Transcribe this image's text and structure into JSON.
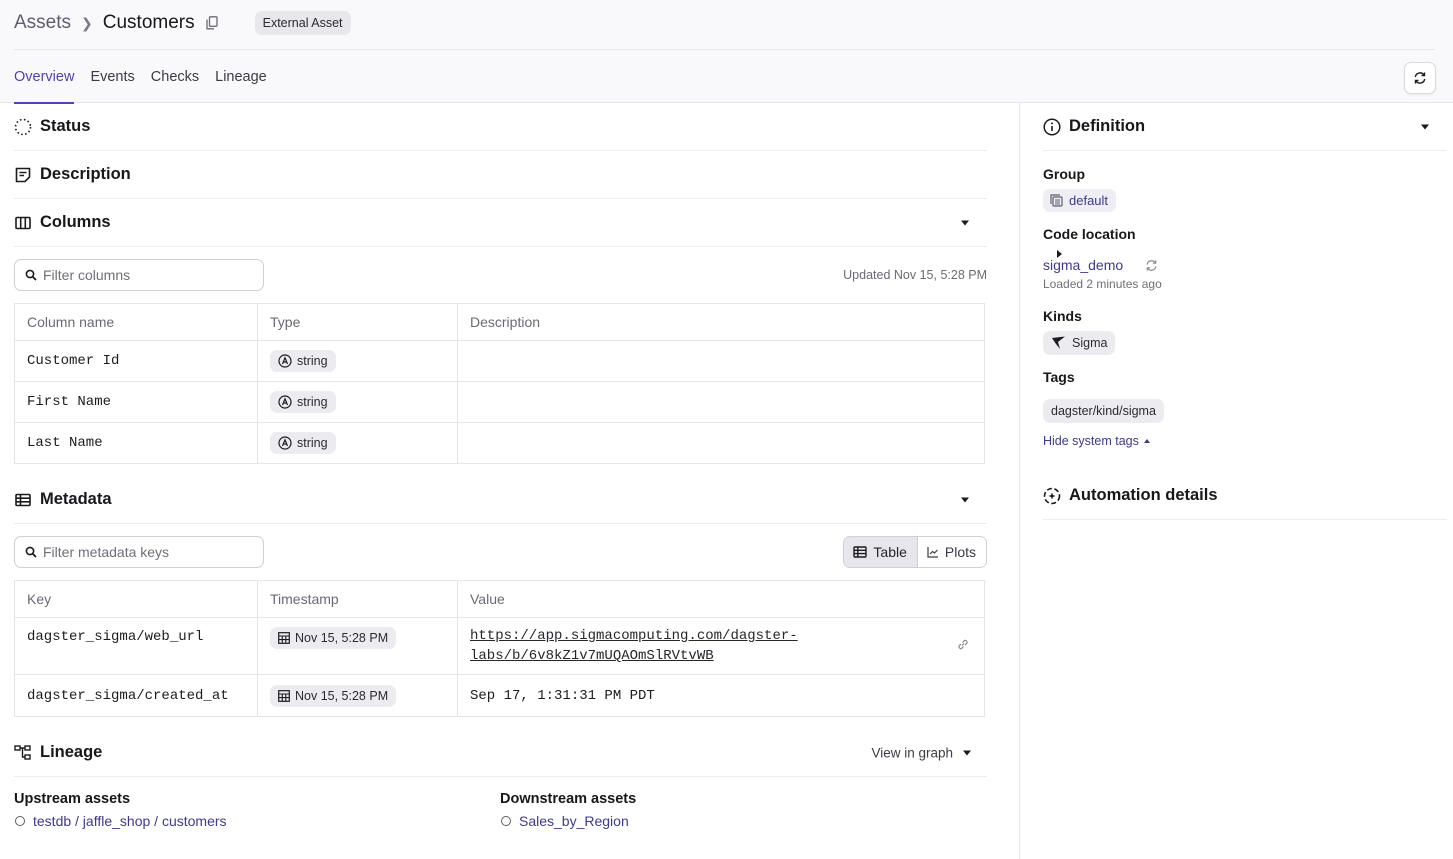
{
  "header": {
    "breadcrumb_root": "Assets",
    "breadcrumb_current": "Customers",
    "badge": "External Asset",
    "tabs": [
      {
        "label": "Overview",
        "active": true
      },
      {
        "label": "Events",
        "active": false
      },
      {
        "label": "Checks",
        "active": false
      },
      {
        "label": "Lineage",
        "active": false
      }
    ],
    "accent_color": "#4f43b0"
  },
  "sections": {
    "status": {
      "title": "Status",
      "icon": "loading-dots-icon",
      "expanded": false
    },
    "description": {
      "title": "Description",
      "icon": "note-icon",
      "expanded": false
    },
    "columns": {
      "title": "Columns",
      "icon": "columns-icon",
      "expanded": true
    },
    "metadata": {
      "title": "Metadata",
      "icon": "table-icon",
      "expanded": true
    },
    "lineage": {
      "title": "Lineage",
      "icon": "lineage-icon",
      "expanded": true
    }
  },
  "columns": {
    "filter_placeholder": "Filter columns",
    "updated": "Updated Nov 15, 5:28 PM",
    "headers": [
      "Column name",
      "Type",
      "Description"
    ],
    "rows": [
      {
        "name": "Customer Id",
        "type": "string",
        "description": ""
      },
      {
        "name": "First Name",
        "type": "string",
        "description": ""
      },
      {
        "name": "Last Name",
        "type": "string",
        "description": ""
      }
    ]
  },
  "metadata": {
    "filter_placeholder": "Filter metadata keys",
    "view_toggle": [
      {
        "label": "Table",
        "active": true
      },
      {
        "label": "Plots",
        "active": false
      }
    ],
    "headers": [
      "Key",
      "Timestamp",
      "Value"
    ],
    "rows": [
      {
        "key": "dagster_sigma/web_url",
        "timestamp": "Nov 15, 5:28 PM",
        "value_line1": "https://app.sigmacomputing.com/dagster-",
        "value_line2": "labs/b/6v8kZ1v7mUQAOmSlRVtvWB"
      },
      {
        "key": "dagster_sigma/created_at",
        "timestamp": "Nov 15, 5:28 PM",
        "value": "Sep 17, 1:31:31 PM PDT"
      }
    ]
  },
  "lineage": {
    "view_in_graph": "View in graph",
    "upstream_title": "Upstream assets",
    "upstream": [
      "testdb / jaffle_shop / customers"
    ],
    "downstream_title": "Downstream assets",
    "downstream": [
      "Sales_by_Region"
    ]
  },
  "definition": {
    "title": "Definition",
    "group_label": "Group",
    "group_value": "default",
    "code_location_label": "Code location",
    "code_location_value": "sigma_demo",
    "loaded": "Loaded 2 minutes ago",
    "kinds_label": "Kinds",
    "kind_value": "Sigma",
    "tags_label": "Tags",
    "tag_value": "dagster/kind/sigma",
    "hide_system_tags": "Hide system tags"
  },
  "automation": {
    "title": "Automation details",
    "expanded": false
  }
}
